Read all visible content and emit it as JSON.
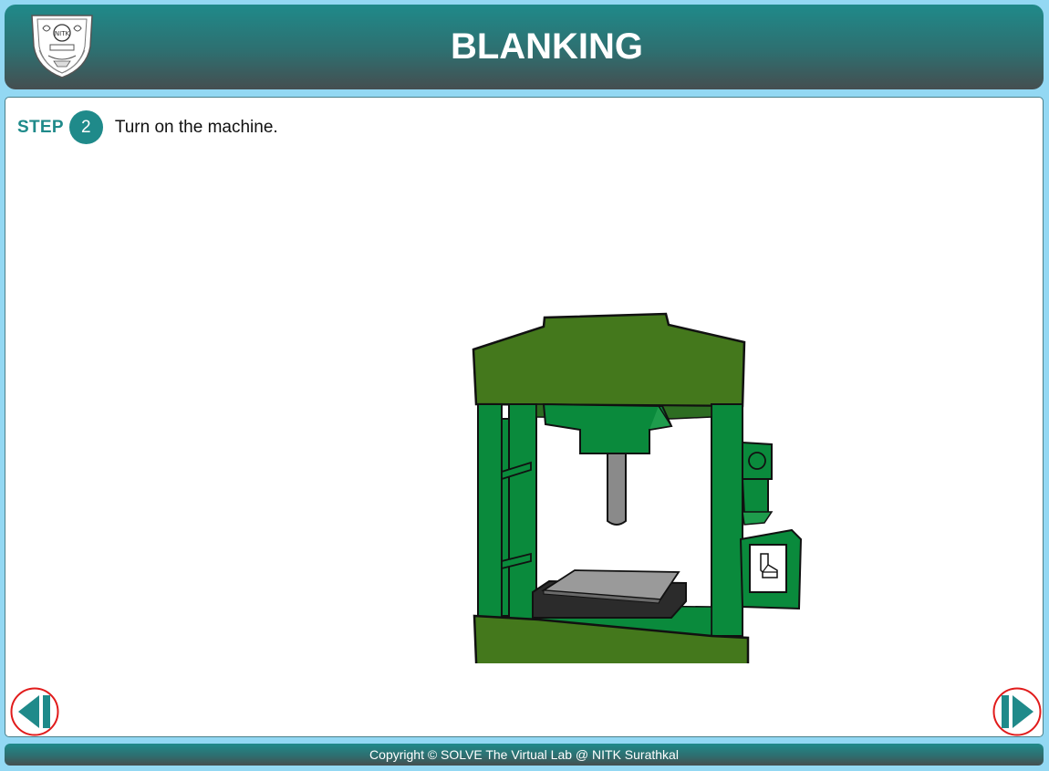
{
  "header": {
    "title": "BLANKING",
    "logo_icon": "nitk-emblem-icon"
  },
  "step": {
    "label": "STEP",
    "number": "2",
    "instruction": "Turn on the machine."
  },
  "machine": {
    "icon": "hydraulic-press-icon",
    "colors": {
      "frame_light": "#0a8a3c",
      "frame_dark": "#44781c",
      "die": "#2b2b2b",
      "plate": "#9a9a9a",
      "ram": "#8a8a8a"
    }
  },
  "navigation": {
    "prev_icon": "previous-icon",
    "next_icon": "next-icon",
    "button_color": "#1f8a8a",
    "ring_color": "#e11b1b"
  },
  "footer": {
    "copyright": "Copyright © SOLVE The Virtual Lab @ NITK Surathkal"
  }
}
